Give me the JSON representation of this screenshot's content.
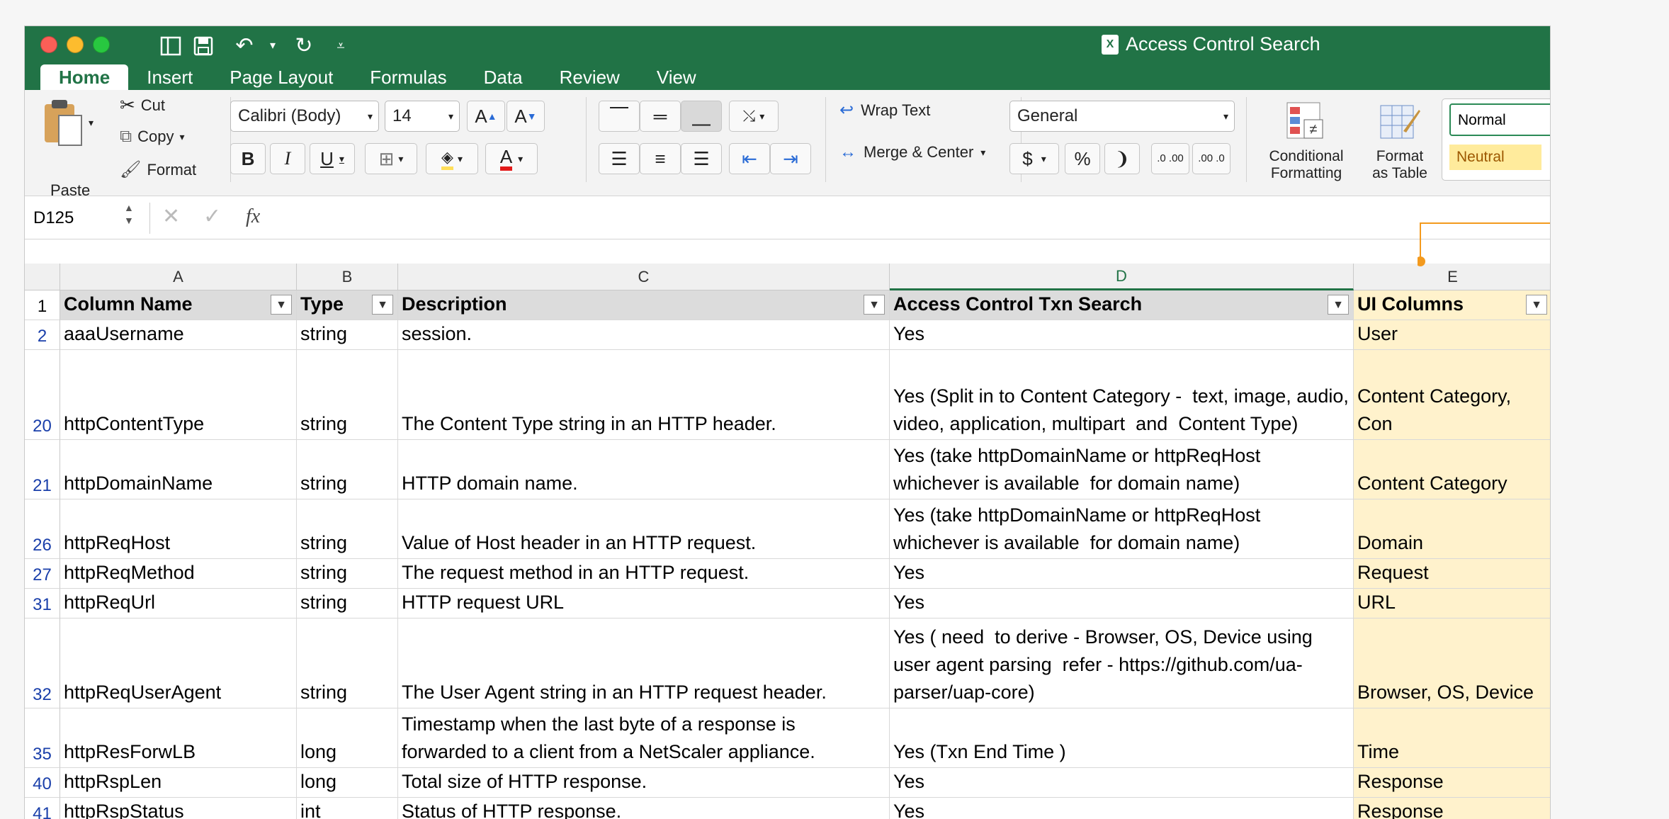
{
  "window": {
    "title": "Access Control Search",
    "accent": "#217346"
  },
  "tabs": [
    "Home",
    "Insert",
    "Page Layout",
    "Formulas",
    "Data",
    "Review",
    "View"
  ],
  "ribbon": {
    "paste": "Paste",
    "cut": "Cut",
    "copy": "Copy",
    "format": "Format",
    "font_name": "Calibri (Body)",
    "font_size": "14",
    "bold": "B",
    "italic": "I",
    "underline": "U",
    "font_color_letter": "A",
    "wrap_text": "Wrap Text",
    "merge_center": "Merge & Center",
    "number_format": "General",
    "currency": "$",
    "percent": "%",
    "dec_inc": ".0 .00",
    "dec_dec": ".00 .0",
    "conditional_1": "Conditional",
    "conditional_2": "Formatting",
    "format_table_1": "Format",
    "format_table_2": "as Table",
    "style_normal": "Normal",
    "style_neutral": "Neutral"
  },
  "formula_bar": {
    "name_box": "D125",
    "fx": "fx",
    "value": ""
  },
  "columns": [
    "A",
    "B",
    "C",
    "D",
    "E"
  ],
  "header_row": {
    "num": "1",
    "a": "Column Name",
    "b": "Type",
    "c": "Description",
    "d": "Access Control Txn Search",
    "e": "UI Columns"
  },
  "rows": [
    {
      "num": "2",
      "a": "aaaUsername",
      "b": "string",
      "c": "session.",
      "d": "Yes",
      "e": "User"
    },
    {
      "num": "20",
      "a": "httpContentType",
      "b": "string",
      "c": "The Content Type string in an HTTP header.",
      "d": "Yes (Split in to Content Category -  text, image, audio, video, application, multipart  and  Content Type)",
      "e": "Content Category, Con"
    },
    {
      "num": "21",
      "a": "httpDomainName",
      "b": "string",
      "c": "HTTP domain name.",
      "d": "Yes (take httpDomainName or httpReqHost whichever is available  for domain name)",
      "e": "Content Category"
    },
    {
      "num": "26",
      "a": "httpReqHost",
      "b": "string",
      "c": "Value of Host header in an HTTP request.",
      "d": "Yes (take httpDomainName or httpReqHost whichever is available  for domain name)",
      "e": "Domain"
    },
    {
      "num": "27",
      "a": "httpReqMethod",
      "b": "string",
      "c": "The request method in an HTTP request.",
      "d": "Yes",
      "e": "Request"
    },
    {
      "num": "31",
      "a": "httpReqUrl",
      "b": "string",
      "c": "HTTP request URL",
      "d": "Yes",
      "e": "URL"
    },
    {
      "num": "32",
      "a": "httpReqUserAgent",
      "b": "string",
      "c": "The User Agent string in an HTTP request header.",
      "d": "Yes ( need  to derive - Browser, OS, Device using user agent parsing  refer - https://github.com/ua-parser/uap-core)",
      "e": "Browser, OS, Device"
    },
    {
      "num": "35",
      "a": "httpResForwLB",
      "b": "long",
      "c": "Timestamp when the last byte of a response is forwarded to a client from a NetScaler appliance.",
      "d": "Yes (Txn End Time )",
      "e": "Time"
    },
    {
      "num": "40",
      "a": "httpRspLen",
      "b": "long",
      "c": "Total size of HTTP response.",
      "d": "Yes",
      "e": "Response"
    },
    {
      "num": "41",
      "a": "httpRspStatus",
      "b": "int",
      "c": "Status of HTTP response.",
      "d": "Yes",
      "e": "Response"
    }
  ],
  "callout": "1"
}
